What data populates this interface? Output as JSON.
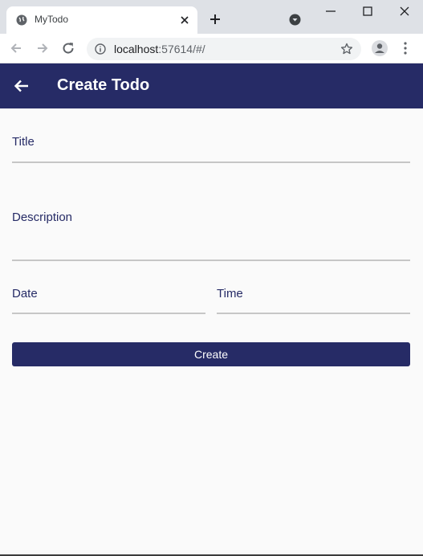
{
  "browser": {
    "tab_title": "MyTodo",
    "url_host": "localhost",
    "url_rest": ":57614/#/"
  },
  "appbar": {
    "title": "Create Todo",
    "color": "#262b66"
  },
  "form": {
    "title_label": "Title",
    "description_label": "Description",
    "date_label": "Date",
    "time_label": "Time",
    "create_label": "Create"
  },
  "colors": {
    "primary": "#262b66",
    "background": "#fafafa",
    "underline": "#c6c6c6"
  },
  "icons": [
    "globe-icon",
    "close-icon",
    "plus-icon",
    "tab-search-icon",
    "minimize-icon",
    "maximize-icon",
    "window-close-icon",
    "back-arrow-icon",
    "forward-arrow-icon",
    "reload-icon",
    "info-icon",
    "star-icon",
    "profile-icon",
    "kebab-menu-icon",
    "app-back-icon"
  ]
}
